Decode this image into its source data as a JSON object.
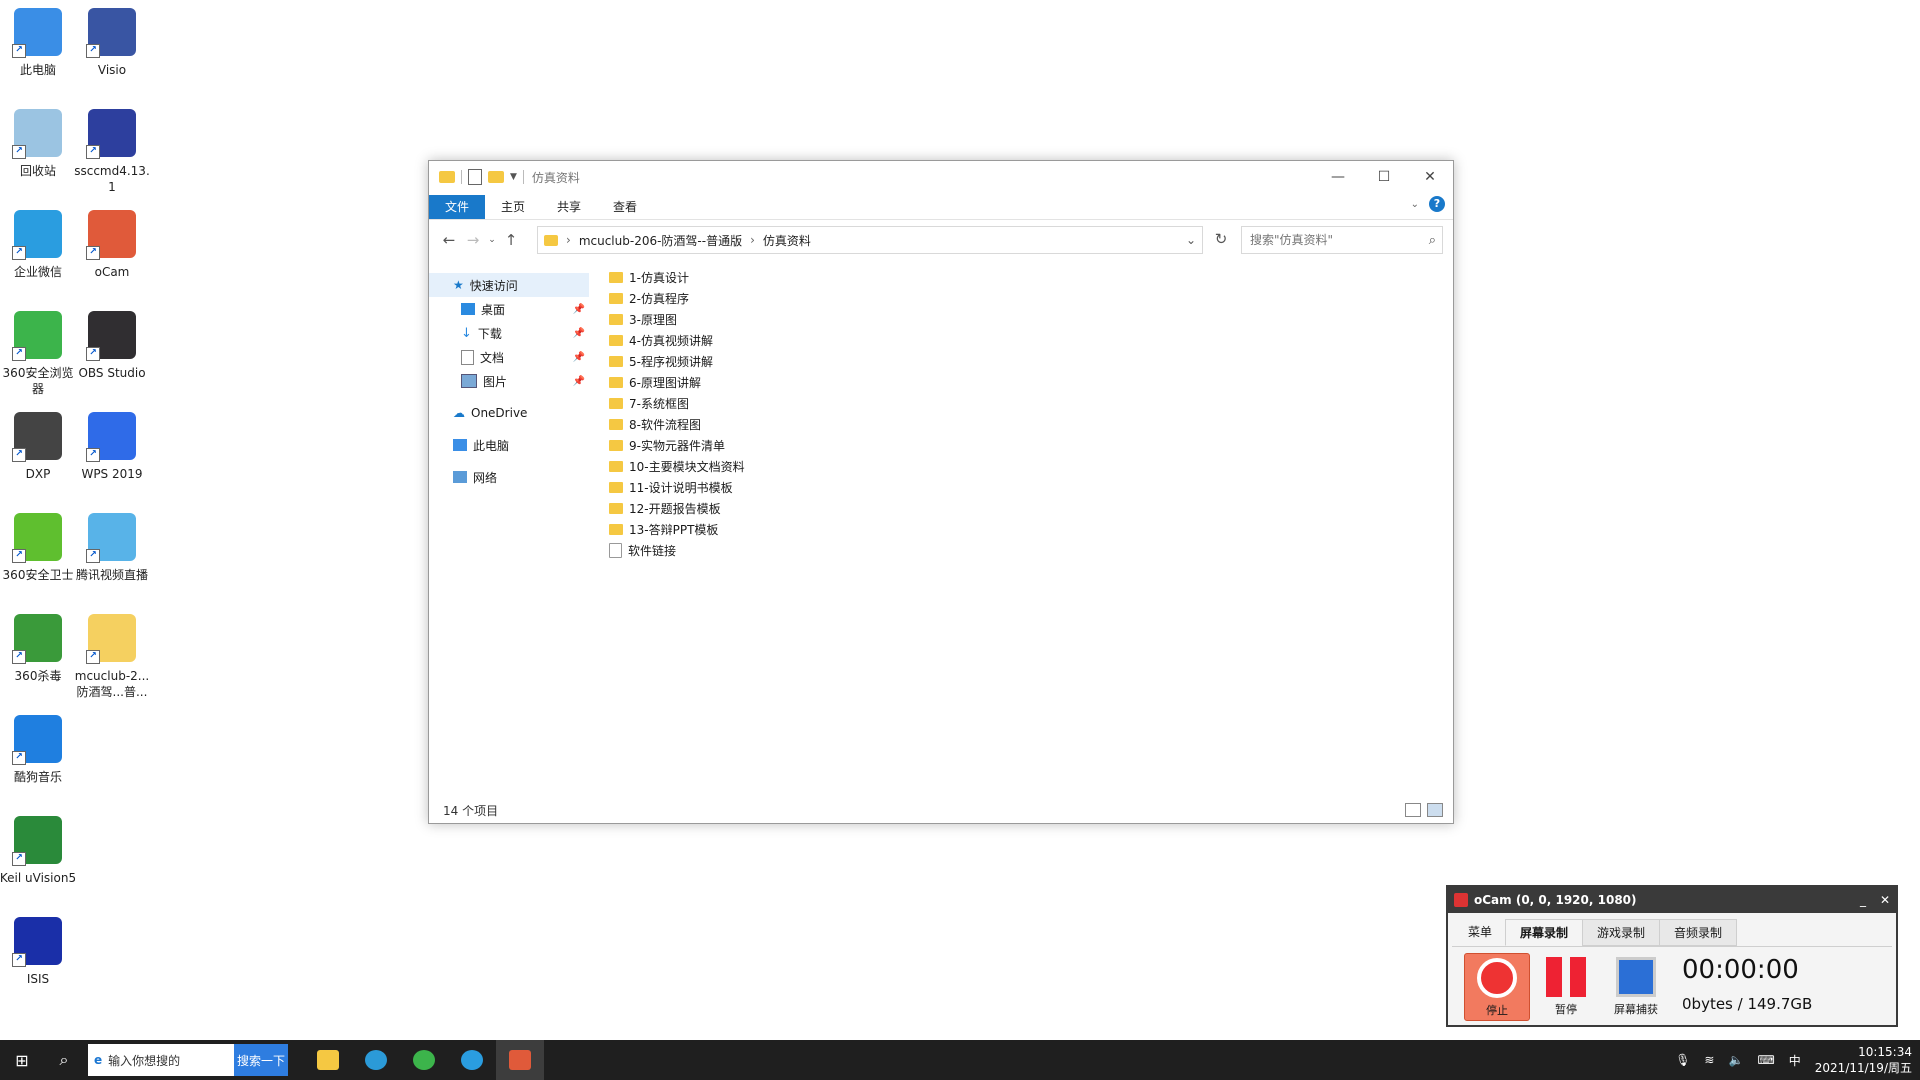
{
  "desktop": {
    "icons": [
      {
        "label": "此电脑",
        "icon": "computer-icon",
        "color": "#3a8ee6"
      },
      {
        "label": "Visio",
        "icon": "visio-icon",
        "color": "#3955a3"
      },
      {
        "label": "回收站",
        "icon": "recycle-bin-icon",
        "color": "#9bc4e2"
      },
      {
        "label": "ssccmd4.13.1",
        "icon": "building-icon",
        "color": "#2d3f9e"
      },
      {
        "label": "企业微信",
        "icon": "wecom-icon",
        "color": "#2a9de0"
      },
      {
        "label": "oCam",
        "icon": "ocam-icon",
        "color": "#e05a3a"
      },
      {
        "label": "360安全浏览器",
        "icon": "360-browser-icon",
        "color": "#3cb44b"
      },
      {
        "label": "OBS Studio",
        "icon": "obs-icon",
        "color": "#302e31"
      },
      {
        "label": "DXP",
        "icon": "dxp-icon",
        "color": "#444444"
      },
      {
        "label": "WPS 2019",
        "icon": "wps-icon",
        "color": "#2f6be8"
      },
      {
        "label": "360安全卫士",
        "icon": "360-guard-icon",
        "color": "#5fbf2f"
      },
      {
        "label": "腾讯视频直播",
        "icon": "live-icon",
        "color": "#58b3e8"
      },
      {
        "label": "360杀毒",
        "icon": "360-antivirus-icon",
        "color": "#3a9a3a"
      },
      {
        "label": "mcuclub-2...防酒驾...普...",
        "icon": "folder-icon",
        "color": "#f5d060"
      },
      {
        "label": "酷狗音乐",
        "icon": "kugou-icon",
        "color": "#1f7fe0"
      },
      {
        "label": "Keil uVision5",
        "icon": "keil-icon",
        "color": "#2a8a3a"
      },
      {
        "label": "ISIS",
        "icon": "isis-icon",
        "color": "#1a2fa8"
      }
    ]
  },
  "explorer": {
    "title": "仿真资料",
    "ribbon_tabs": [
      "文件",
      "主页",
      "共享",
      "查看"
    ],
    "help": "?",
    "address": {
      "crumb1": "mcuclub-206-防酒驾--普通版",
      "crumb2": "仿真资料"
    },
    "search_placeholder": "搜索\"仿真资料\"",
    "nav": {
      "quick_access": "快速访问",
      "desktop": "桌面",
      "downloads": "下载",
      "documents": "文档",
      "pictures": "图片",
      "onedrive": "OneDrive",
      "this_pc": "此电脑",
      "network": "网络"
    },
    "files": [
      {
        "name": "1-仿真设计",
        "type": "folder"
      },
      {
        "name": "2-仿真程序",
        "type": "folder"
      },
      {
        "name": "3-原理图",
        "type": "folder"
      },
      {
        "name": "4-仿真视频讲解",
        "type": "folder"
      },
      {
        "name": "5-程序视频讲解",
        "type": "folder"
      },
      {
        "name": "6-原理图讲解",
        "type": "folder"
      },
      {
        "name": "7-系统框图",
        "type": "folder"
      },
      {
        "name": "8-软件流程图",
        "type": "folder"
      },
      {
        "name": "9-实物元器件清单",
        "type": "folder"
      },
      {
        "name": "10-主要模块文档资料",
        "type": "folder"
      },
      {
        "name": "11-设计说明书模板",
        "type": "folder"
      },
      {
        "name": "12-开题报告模板",
        "type": "folder"
      },
      {
        "name": "13-答辩PPT模板",
        "type": "folder"
      },
      {
        "name": "软件链接",
        "type": "file"
      }
    ],
    "status": "14 个项目"
  },
  "ocam": {
    "title": "oCam (0, 0, 1920, 1080)",
    "tabs": {
      "menu": "菜单",
      "screen": "屏幕录制",
      "game": "游戏录制",
      "audio": "音频录制"
    },
    "buttons": {
      "stop": "停止",
      "pause": "暂停",
      "capture": "屏幕捕获"
    },
    "timer": "00:00:00",
    "size": "0bytes / 149.7GB"
  },
  "taskbar": {
    "search_placeholder": "输入你想搜的",
    "search_button": "搜索一下",
    "ime": "中",
    "time": "10:15:34",
    "date": "2021/11/19/周五"
  }
}
